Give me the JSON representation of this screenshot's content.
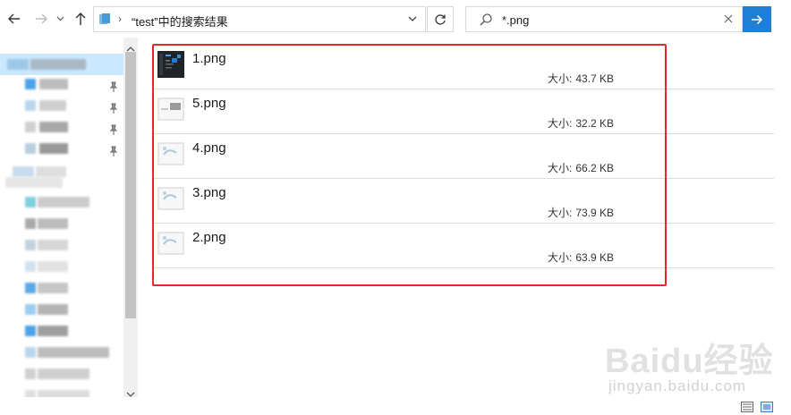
{
  "address_bar": {
    "path_text": "“test”中的搜索结果"
  },
  "search": {
    "value": "*.png"
  },
  "results": [
    {
      "name": "1.png",
      "size_label": "大小:",
      "size_value": "43.7 KB"
    },
    {
      "name": "5.png",
      "size_label": "大小:",
      "size_value": "32.2 KB"
    },
    {
      "name": "4.png",
      "size_label": "大小:",
      "size_value": "66.2 KB"
    },
    {
      "name": "3.png",
      "size_label": "大小:",
      "size_value": "73.9 KB"
    },
    {
      "name": "2.png",
      "size_label": "大小:",
      "size_value": "63.9 KB"
    }
  ],
  "watermark": {
    "logo": "Baidu经验",
    "url": "jingyan.baidu.com"
  },
  "colors": {
    "accent": "#1e7fd6",
    "highlight_border": "#e32a2a",
    "nav_selected": "#cce8ff"
  }
}
